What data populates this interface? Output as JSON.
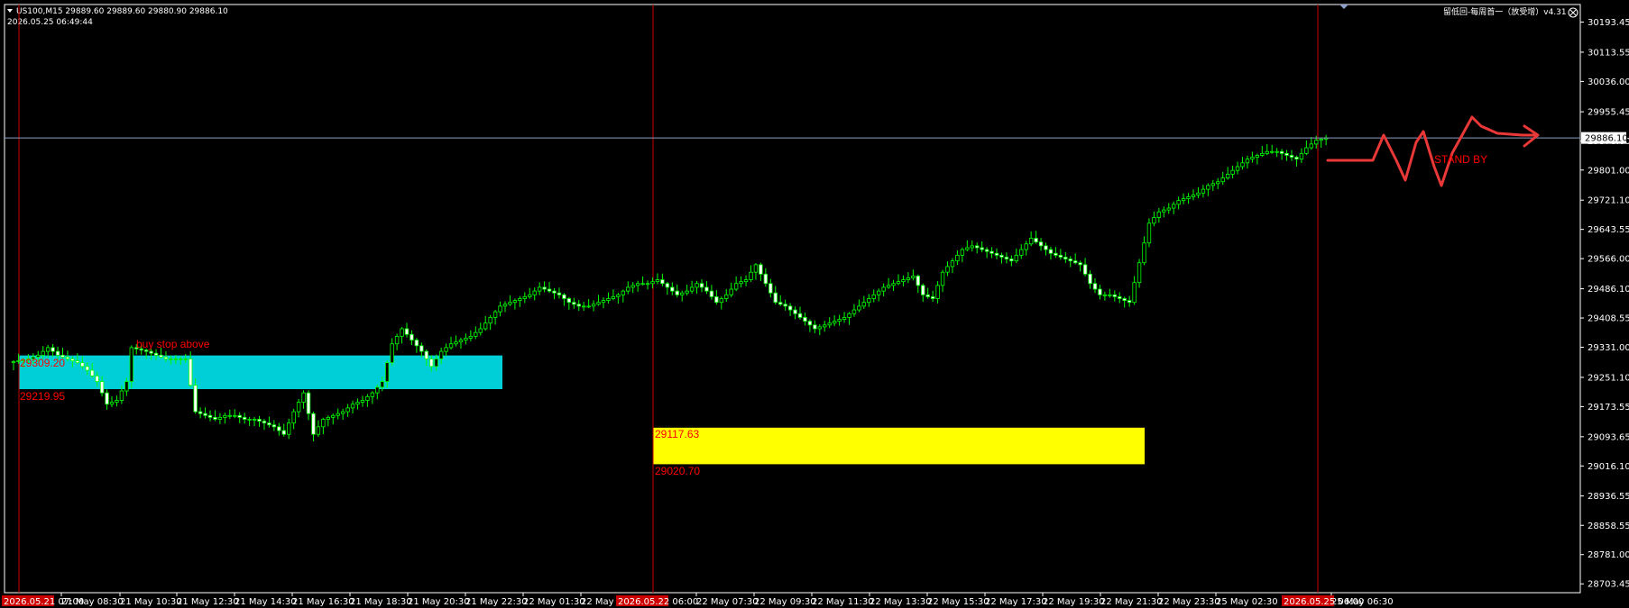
{
  "header": {
    "symbol_line": "US100,M15  29889.60 29889.60 29880.90 29886.10",
    "datetime": "2026.05.25 06:49:44",
    "indicator": "留低回-每周首一（放受增）v4.31"
  },
  "colors": {
    "background": "#000000",
    "axis": "#ffffff",
    "candle_up_body": "#000000",
    "candle_down_body": "#ffffff",
    "candle_outline": "#00ff00",
    "bid_line": "#8aa0c8",
    "vline": "#cc0000",
    "zone_cyan": "#00cfd8",
    "zone_yellow": "#ffff00",
    "label_red": "#ff0000"
  },
  "chart_data": {
    "type": "candlestick",
    "symbol": "US100",
    "timeframe": "M15",
    "ylim": [
      28680,
      30240
    ],
    "ticks": [
      30193.45,
      30113.55,
      30036.0,
      29955.45,
      29878.0,
      29801.0,
      29721.1,
      29643.55,
      29566.0,
      29486.1,
      29408.55,
      29331.0,
      29251.1,
      29173.55,
      29093.65,
      29016.1,
      28936.55,
      28858.55,
      28781.0,
      28703.45
    ],
    "current_price": "29886.10",
    "current_price_value": 29886.1,
    "x_labels": [
      "21 May 08:30",
      "21 May 10:30",
      "21 May 12:30",
      "21 May 14:30",
      "21 May 16:30",
      "21 May 18:30",
      "21 May 20:30",
      "21 May 22:30",
      "22 May 01:30",
      "22 May 03:30",
      "22 May 07:30",
      "22 May 09:30",
      "22 May 11:30",
      "22 May 13:30",
      "22 May 15:30",
      "22 May 17:30",
      "22 May 19:30",
      "22 May 21:30",
      "22 May 23:30",
      "25 May 02:30",
      "25 May 06:30"
    ],
    "highlighted_x_labels": [
      "2026.05.21 07:00",
      "2026.05.22 06:00",
      "2026.05.25 06:00"
    ],
    "series_points": [
      [
        0,
        29290
      ],
      [
        4,
        29300
      ],
      [
        6,
        29310
      ],
      [
        8,
        29330
      ],
      [
        10,
        29310
      ],
      [
        14,
        29290
      ],
      [
        16,
        29270
      ],
      [
        18,
        29240
      ],
      [
        20,
        29180
      ],
      [
        22,
        29190
      ],
      [
        24,
        29240
      ],
      [
        25,
        29330
      ],
      [
        28,
        29320
      ],
      [
        30,
        29310
      ],
      [
        32,
        29300
      ],
      [
        34,
        29300
      ],
      [
        36,
        29300
      ],
      [
        38,
        29160
      ],
      [
        40,
        29150
      ],
      [
        42,
        29140
      ],
      [
        44,
        29150
      ],
      [
        46,
        29150
      ],
      [
        48,
        29140
      ],
      [
        50,
        29140
      ],
      [
        52,
        29130
      ],
      [
        54,
        29120
      ],
      [
        56,
        29100
      ],
      [
        58,
        29160
      ],
      [
        60,
        29210
      ],
      [
        62,
        29100
      ],
      [
        64,
        29140
      ],
      [
        66,
        29150
      ],
      [
        68,
        29160
      ],
      [
        70,
        29180
      ],
      [
        72,
        29190
      ],
      [
        74,
        29210
      ],
      [
        76,
        29240
      ],
      [
        78,
        29340
      ],
      [
        80,
        29380
      ],
      [
        82,
        29350
      ],
      [
        84,
        29320
      ],
      [
        86,
        29280
      ],
      [
        88,
        29320
      ],
      [
        90,
        29340
      ],
      [
        92,
        29350
      ],
      [
        94,
        29360
      ],
      [
        96,
        29380
      ],
      [
        98,
        29410
      ],
      [
        100,
        29440
      ],
      [
        102,
        29450
      ],
      [
        104,
        29460
      ],
      [
        106,
        29470
      ],
      [
        108,
        29490
      ],
      [
        110,
        29480
      ],
      [
        112,
        29470
      ],
      [
        114,
        29450
      ],
      [
        116,
        29440
      ],
      [
        118,
        29440
      ],
      [
        120,
        29450
      ],
      [
        122,
        29460
      ],
      [
        124,
        29470
      ],
      [
        126,
        29490
      ],
      [
        128,
        29500
      ],
      [
        130,
        29500
      ],
      [
        132,
        29510
      ],
      [
        134,
        29490
      ],
      [
        136,
        29470
      ],
      [
        138,
        29480
      ],
      [
        140,
        29500
      ],
      [
        142,
        29480
      ],
      [
        144,
        29450
      ],
      [
        146,
        29470
      ],
      [
        148,
        29500
      ],
      [
        150,
        29510
      ],
      [
        152,
        29550
      ],
      [
        154,
        29500
      ],
      [
        156,
        29450
      ],
      [
        158,
        29440
      ],
      [
        160,
        29420
      ],
      [
        162,
        29400
      ],
      [
        164,
        29380
      ],
      [
        166,
        29390
      ],
      [
        168,
        29400
      ],
      [
        170,
        29410
      ],
      [
        172,
        29430
      ],
      [
        174,
        29450
      ],
      [
        176,
        29470
      ],
      [
        178,
        29490
      ],
      [
        180,
        29500
      ],
      [
        182,
        29510
      ],
      [
        184,
        29520
      ],
      [
        186,
        29470
      ],
      [
        188,
        29460
      ],
      [
        190,
        29530
      ],
      [
        192,
        29560
      ],
      [
        194,
        29590
      ],
      [
        196,
        29600
      ],
      [
        198,
        29590
      ],
      [
        200,
        29580
      ],
      [
        202,
        29570
      ],
      [
        204,
        29560
      ],
      [
        206,
        29590
      ],
      [
        208,
        29620
      ],
      [
        210,
        29600
      ],
      [
        212,
        29580
      ],
      [
        214,
        29570
      ],
      [
        216,
        29560
      ],
      [
        218,
        29550
      ],
      [
        220,
        29500
      ],
      [
        222,
        29470
      ],
      [
        224,
        29470
      ],
      [
        226,
        29460
      ],
      [
        228,
        29450
      ],
      [
        232,
        29660
      ],
      [
        234,
        29690
      ],
      [
        236,
        29700
      ],
      [
        238,
        29720
      ],
      [
        240,
        29730
      ],
      [
        242,
        29740
      ],
      [
        244,
        29760
      ],
      [
        246,
        29770
      ],
      [
        248,
        29790
      ],
      [
        250,
        29810
      ],
      [
        252,
        29830
      ],
      [
        254,
        29840
      ],
      [
        256,
        29850
      ],
      [
        258,
        29850
      ],
      [
        260,
        29840
      ],
      [
        262,
        29830
      ],
      [
        264,
        29860
      ],
      [
        266,
        29880
      ],
      [
        268,
        29886
      ]
    ],
    "annotations": [
      {
        "text": "buy stop above",
        "type": "label"
      },
      {
        "text": "29309.20",
        "type": "zone-top"
      },
      {
        "text": "29219.95",
        "type": "zone-bottom"
      },
      {
        "text": "29117.63",
        "type": "zone-top"
      },
      {
        "text": "29020.70",
        "type": "zone-bottom"
      },
      {
        "text": "STAND BY",
        "type": "label"
      }
    ],
    "zones": [
      {
        "name": "cyan-zone",
        "top": 29309.2,
        "bottom": 29219.95,
        "color": "#00cfd8"
      },
      {
        "name": "yellow-zone",
        "top": 29117.63,
        "bottom": 29020.7,
        "color": "#ffff00"
      }
    ]
  }
}
